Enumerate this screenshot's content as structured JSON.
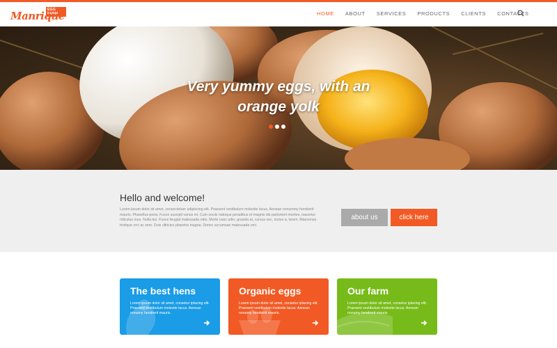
{
  "header": {
    "logo_badge": "EGG FARM",
    "logo_text": "Manrique",
    "nav": [
      "HOME",
      "ABOUT",
      "SERVICES",
      "PRODUCTS",
      "CLIENTS",
      "CONTACTS"
    ],
    "active_nav": "HOME",
    "search_icon": "search-icon"
  },
  "hero": {
    "heading": "Very yummy eggs, with an orange yolk",
    "slides": 3,
    "active_slide": 1
  },
  "welcome": {
    "title": "Hello and welcome!",
    "body": "Lorem ipsum dolor sit amet, consectetuer adipiscing elit. Praesent vestibulum molestie lacus. Aenean nonummy hendrerit mauris. Phasellus porta. Fusce suscipit varius mi. Cum sociis natoque penatibus et magnis dis parturient montes, nascetur ridiculus mus. Nulla dui. Fusce feugiat malesuada odio. Morbi nunc odio, gravida at, cursus nec, luctus a, lorem. Maecenas tristique orci ac sem. Duis ultricies pharetra magna. Donec accumsan malesuada orci.",
    "about_button": "about us",
    "click_button": "click here"
  },
  "features": [
    {
      "title": "The best hens",
      "body": "Lorem ipsum dolor sit amet, consetur iplacing elit. Praesent vestibulum molestie lacus. Aenean nonumy hendrerit mauris.",
      "color": "#1a9ce6"
    },
    {
      "title": "Organic eggs",
      "body": "Lorem ipsum dolor sit amet, consetur iplacing elit. Praesent vestibulum molestie lacus. Aenean nonumy hendrerit mauris.",
      "color": "#f15a24"
    },
    {
      "title": "Our farm",
      "body": "Lorem ipsum dolor sit amet, consetur iplacing elit. Praesent vestibulum molestie lacus. Aenean nonumy hendrerit mauris.",
      "color": "#77bb1a"
    }
  ],
  "colors": {
    "accent": "#f15a24",
    "welcome_bg": "#efefef",
    "button_grey": "#aaaaaa"
  }
}
